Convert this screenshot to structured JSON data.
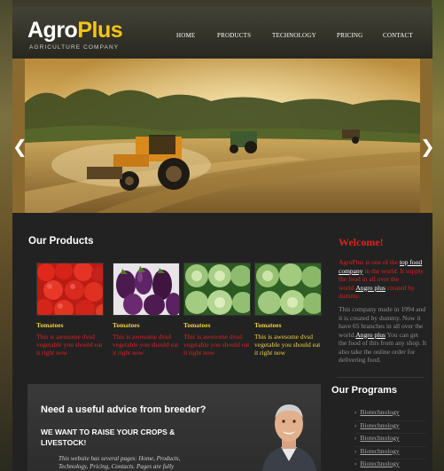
{
  "brand": {
    "name_part1": "Agro",
    "name_part2": "Plus",
    "tagline": "AGRICULTURE COMPANY"
  },
  "nav": [
    "HOME",
    "PRODUCTS",
    "TECHNOLOGY",
    "PRICING",
    "CONTACT"
  ],
  "slider": {
    "prev_icon": "chevron-left-icon",
    "next_icon": "chevron-right-icon",
    "prev_glyph": "❮",
    "next_glyph": "❯"
  },
  "products": {
    "title": "Our Products",
    "items": [
      {
        "name": "Tomatoes",
        "desc": "This is awesome dvsd vegetable you should eat it right now",
        "image": "tomatoes-image",
        "desc_color": "#e02020"
      },
      {
        "name": "Tomatoes",
        "desc": "This is awesome dvsd vegetable you should eat it right now",
        "image": "eggplant-image",
        "desc_color": "#e02020"
      },
      {
        "name": "Tomatoes",
        "desc": "This is awesome dvsd vegetable you should eat it right now",
        "image": "cabbage-image",
        "desc_color": "#e02020"
      },
      {
        "name": "Tomatoes",
        "desc": "This is awesome dvsd vegetable you should eat it right now",
        "image": "cabbage-image",
        "desc_color": "#f0d040"
      }
    ]
  },
  "welcome": {
    "title": "Welcome!",
    "p1_a": "AgroPlus is one of the ",
    "p1_link1": "top food company",
    "p1_b": " in the world. It supply the food in all over the world.",
    "p1_link2": "Angro plus",
    "p1_c": " created by dummy.",
    "p2_a": "This company made in 1994 and it is created by dummy. Now it have 65 branches in all over the world.",
    "p2_link": "Angro plus",
    "p2_b": " You can get the food of this from any shop. It also take the online order for delivering food."
  },
  "programs": {
    "title": "Our Programs",
    "items": [
      "Biotechnology",
      "Biotechnology",
      "Biotechnology",
      "Biotechnology",
      "Biotechnology"
    ]
  },
  "advice": {
    "title": "Need a useful advice from breeder?",
    "subtitle": "WE WANT TO RAISE YOUR CROPS & LIVESTOCK!",
    "body": "This website has several pages: Home, Products, Technology, Pricing, Contacts. Pages are fully functional..."
  },
  "colors": {
    "accent_yellow": "#f5c518",
    "accent_red": "#e02020",
    "background": "#1c1c1c"
  }
}
